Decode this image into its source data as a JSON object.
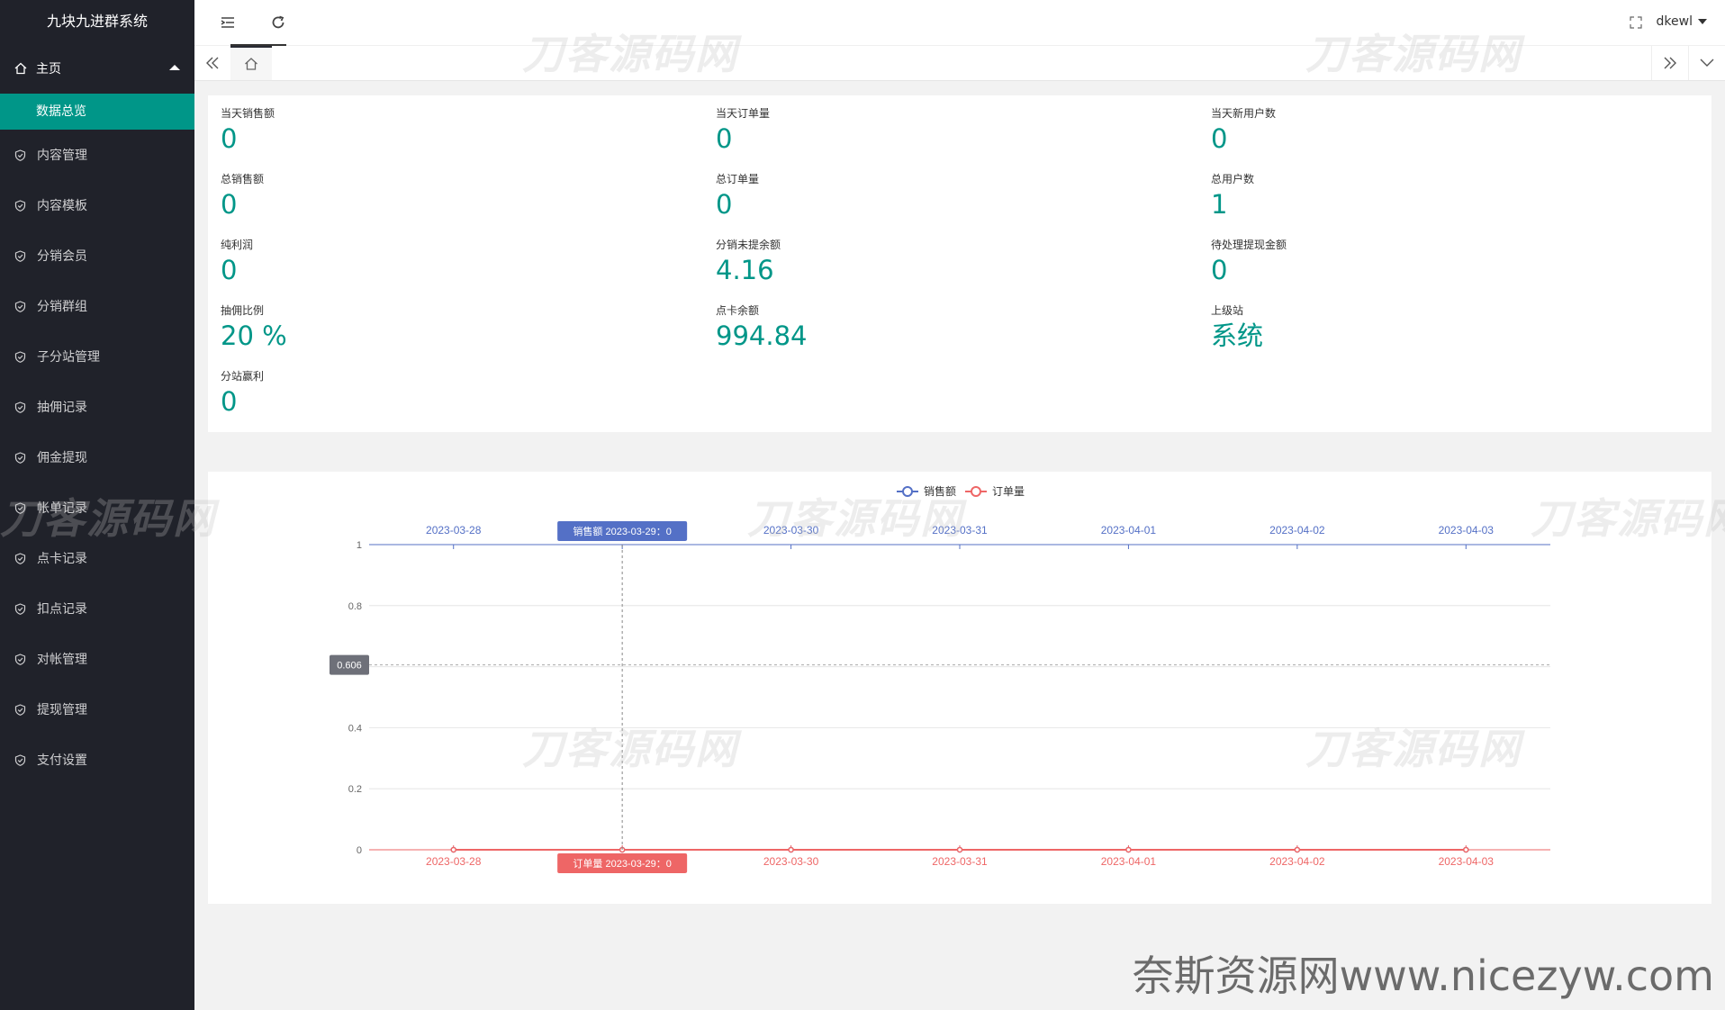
{
  "app": {
    "title": "九块九进群系统"
  },
  "sidebar": {
    "main": {
      "label": "主页",
      "icon": "home-icon"
    },
    "sub": {
      "label": "数据总览"
    },
    "items": [
      {
        "label": "内容管理",
        "icon": "shield-icon"
      },
      {
        "label": "内容模板",
        "icon": "shield-icon"
      },
      {
        "label": "分销会员",
        "icon": "shield-icon"
      },
      {
        "label": "分销群组",
        "icon": "shield-icon"
      },
      {
        "label": "子分站管理",
        "icon": "shield-icon"
      },
      {
        "label": "抽佣记录",
        "icon": "shield-icon"
      },
      {
        "label": "佣金提现",
        "icon": "shield-icon"
      },
      {
        "label": "帐单记录",
        "icon": "shield-icon"
      },
      {
        "label": "点卡记录",
        "icon": "shield-icon"
      },
      {
        "label": "扣点记录",
        "icon": "shield-icon"
      },
      {
        "label": "对帐管理",
        "icon": "shield-icon"
      },
      {
        "label": "提现管理",
        "icon": "shield-icon"
      },
      {
        "label": "支付设置",
        "icon": "shield-icon"
      }
    ]
  },
  "header": {
    "user": "dkewl"
  },
  "stats": [
    {
      "label": "当天销售额",
      "value": "0"
    },
    {
      "label": "当天订单量",
      "value": "0"
    },
    {
      "label": "当天新用户数",
      "value": "0"
    },
    {
      "label": "总销售额",
      "value": "0"
    },
    {
      "label": "总订单量",
      "value": "0"
    },
    {
      "label": "总用户数",
      "value": "1"
    },
    {
      "label": "纯利润",
      "value": "0"
    },
    {
      "label": "分销未提余额",
      "value": "4.16"
    },
    {
      "label": "待处理提现金额",
      "value": "0"
    },
    {
      "label": "抽佣比例",
      "value": "20 %"
    },
    {
      "label": "点卡余额",
      "value": "994.84"
    },
    {
      "label": "上级站",
      "value": "系统"
    },
    {
      "label": "分站赢利",
      "value": "0"
    }
  ],
  "chart_data": {
    "type": "line",
    "categories": [
      "2023-03-28",
      "2023-03-29",
      "2023-03-30",
      "2023-03-31",
      "2023-04-01",
      "2023-04-02",
      "2023-04-03"
    ],
    "series": [
      {
        "name": "销售额",
        "values": [
          0,
          0,
          0,
          0,
          0,
          0,
          0
        ],
        "color": "#5470c6"
      },
      {
        "name": "订单量",
        "values": [
          0,
          0,
          0,
          0,
          0,
          0,
          0
        ],
        "color": "#ee6666"
      }
    ],
    "yticks": [
      "0",
      "0.2",
      "0.4",
      "0.6",
      "0.8",
      "1"
    ],
    "ylim": [
      0,
      1
    ],
    "legend": "top-center",
    "tooltip": {
      "category_index": 1,
      "y_value": 0.606,
      "y_label": "0.606",
      "top_label": "销售额  2023-03-29：0",
      "bottom_label": "订单量  2023-03-29：0"
    }
  },
  "watermarks": {
    "text": "刀客源码网",
    "bottom": "奈斯资源网www.nicezyw.com"
  }
}
